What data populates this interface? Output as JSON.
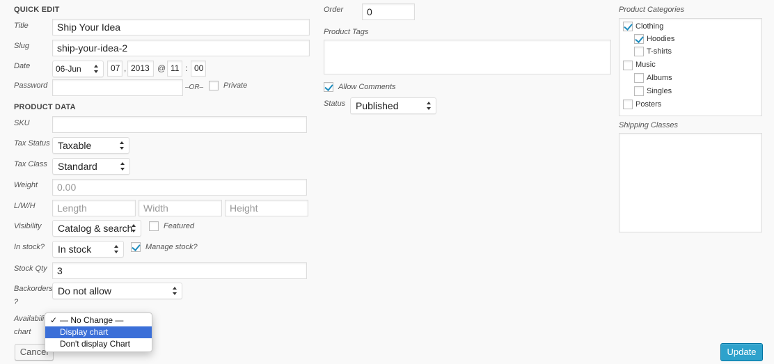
{
  "quick_edit": {
    "header": "QUICK EDIT",
    "title_label": "Title",
    "title_value": "Ship Your Idea",
    "slug_label": "Slug",
    "slug_value": "ship-your-idea-2",
    "date_label": "Date",
    "date_month": "06-Jun",
    "date_day": "07",
    "date_comma": ",",
    "date_year": "2013",
    "date_at": "@",
    "date_hour": "11",
    "date_colon": ":",
    "date_minute": "00",
    "password_label": "Password",
    "password_value": "",
    "or_text": "–OR–",
    "private_label": "Private"
  },
  "product_data": {
    "header": "PRODUCT DATA",
    "sku_label": "SKU",
    "sku_value": "",
    "tax_status_label": "Tax Status",
    "tax_status_value": "Taxable",
    "tax_class_label": "Tax Class",
    "tax_class_value": "Standard",
    "weight_label": "Weight",
    "weight_placeholder": "0.00",
    "lwh_label": "L/W/H",
    "length_placeholder": "Length",
    "width_placeholder": "Width",
    "height_placeholder": "Height",
    "visibility_label": "Visibility",
    "visibility_value": "Catalog & search",
    "featured_label": "Featured",
    "in_stock_label": "In stock?",
    "in_stock_value": "In stock",
    "manage_stock_label": "Manage stock?",
    "stock_qty_label": "Stock Qty",
    "stock_qty_value": "3",
    "backorders_label_1": "Backorders",
    "backorders_label_2": "?",
    "backorders_value": "Do not allow",
    "availability_label_1": "Availabili",
    "availability_label_2": "chart",
    "dropdown_options": [
      "— No Change —",
      "Display chart",
      "Don't display Chart"
    ],
    "dropdown_check": "✓"
  },
  "middle": {
    "order_label": "Order",
    "order_value": "0",
    "tags_label": "Product Tags",
    "allow_comments_label": "Allow Comments",
    "status_label": "Status",
    "status_value": "Published"
  },
  "right": {
    "categories_label": "Product Categories",
    "categories": [
      {
        "label": "Clothing",
        "checked": true,
        "level": 0
      },
      {
        "label": "Hoodies",
        "checked": true,
        "level": 1
      },
      {
        "label": "T-shirts",
        "checked": false,
        "level": 1
      },
      {
        "label": "Music",
        "checked": false,
        "level": 0
      },
      {
        "label": "Albums",
        "checked": false,
        "level": 1
      },
      {
        "label": "Singles",
        "checked": false,
        "level": 1
      },
      {
        "label": "Posters",
        "checked": false,
        "level": 0
      }
    ],
    "shipping_label": "Shipping Classes"
  },
  "buttons": {
    "cancel": "Cancel",
    "update": "Update"
  },
  "colors": {
    "accent": "#2ea2cc",
    "check": "#1e8cbe",
    "highlight": "#3b6fd8"
  }
}
